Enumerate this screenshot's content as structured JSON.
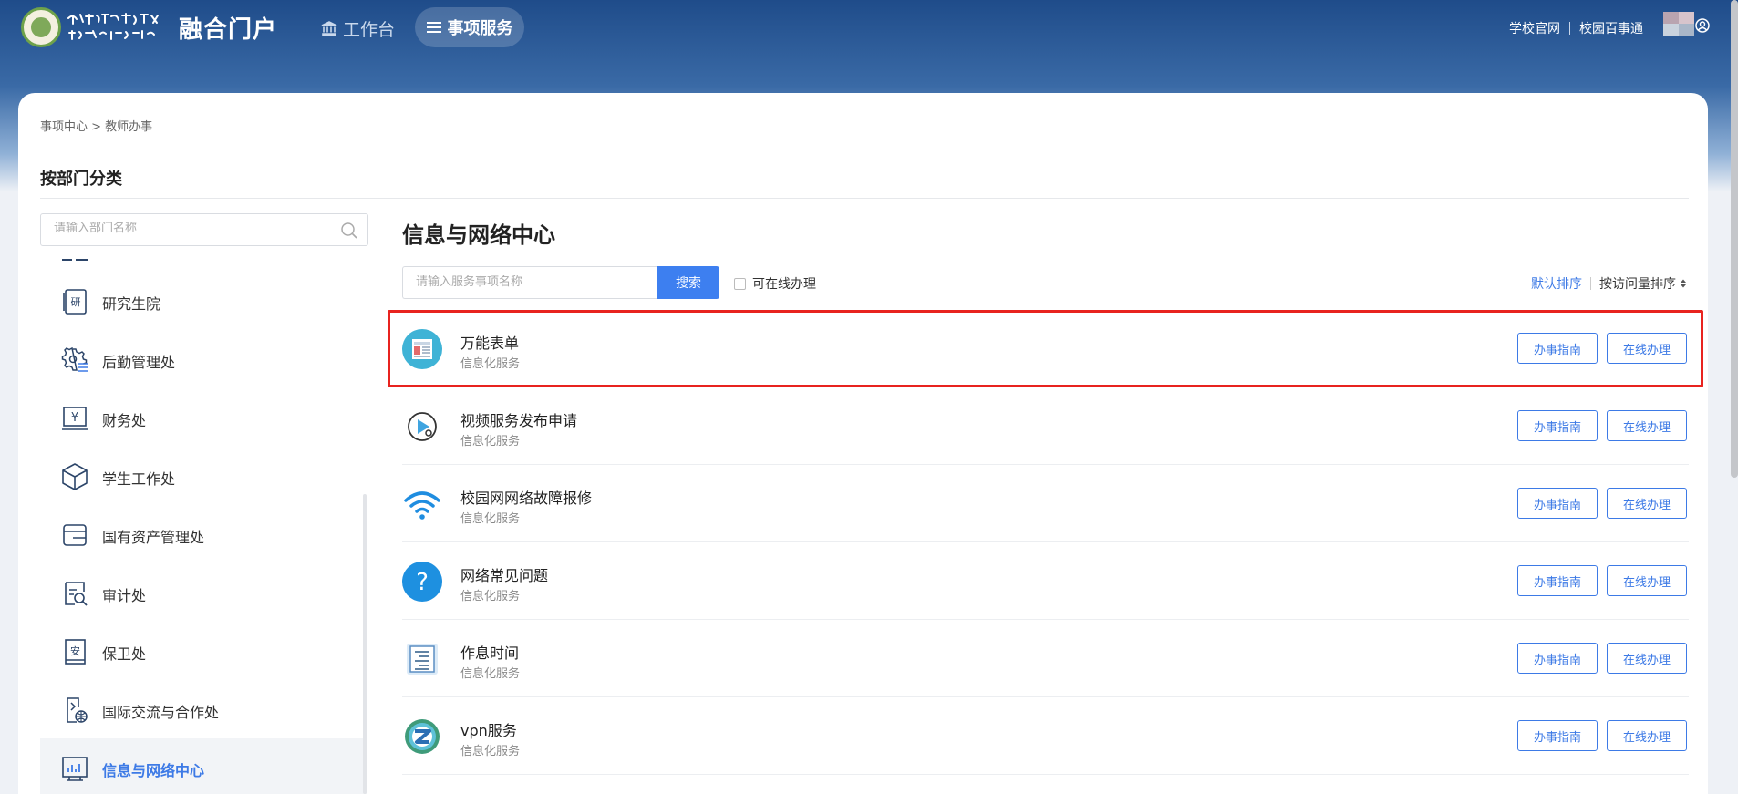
{
  "header": {
    "logo_alt": "内蒙古农业大学",
    "brand": "融合门户",
    "nav": {
      "workbench": "工作台",
      "service": "事项服务"
    },
    "links": [
      "学校官网",
      "校园百事通"
    ]
  },
  "breadcrumb": "事项中心 > 教师办事",
  "section_title": "按部门分类",
  "dept_search": {
    "placeholder": "请输入部门名称"
  },
  "sidebar": {
    "items": [
      {
        "label": "研究生院",
        "icon": "graduate-school-icon"
      },
      {
        "label": "后勤管理处",
        "icon": "logistics-gear-icon"
      },
      {
        "label": "财务处",
        "icon": "finance-yuan-icon"
      },
      {
        "label": "学生工作处",
        "icon": "cube-icon"
      },
      {
        "label": "国有资产管理处",
        "icon": "asset-card-icon"
      },
      {
        "label": "审计处",
        "icon": "audit-search-icon"
      },
      {
        "label": "保卫处",
        "icon": "security-book-icon"
      },
      {
        "label": "国际交流与合作处",
        "icon": "international-globe-icon"
      },
      {
        "label": "信息与网络中心",
        "icon": "network-chart-icon",
        "active": true
      }
    ]
  },
  "main": {
    "title": "信息与网络中心",
    "search": {
      "placeholder": "请输入服务事项名称",
      "button": "搜索"
    },
    "online_only": "可在线办理",
    "sort": {
      "default": "默认排序",
      "by_visits": "按访问量排序"
    },
    "services": [
      {
        "name": "万能表单",
        "category": "信息化服务",
        "icon": "form-icon"
      },
      {
        "name": "视频服务发布申请",
        "category": "信息化服务",
        "icon": "video-play-icon"
      },
      {
        "name": "校园网网络故障报修",
        "category": "信息化服务",
        "icon": "wifi-icon"
      },
      {
        "name": "网络常见问题",
        "category": "信息化服务",
        "icon": "question-icon"
      },
      {
        "name": "作息时间",
        "category": "信息化服务",
        "icon": "schedule-list-icon"
      },
      {
        "name": "vpn服务",
        "category": "信息化服务",
        "icon": "vpn-icon"
      }
    ],
    "guide_button": "办事指南",
    "online_button": "在线办理"
  },
  "colors": {
    "accent": "#3d7ae6",
    "highlight": "#e8231f",
    "header": "#1f4c8a"
  }
}
